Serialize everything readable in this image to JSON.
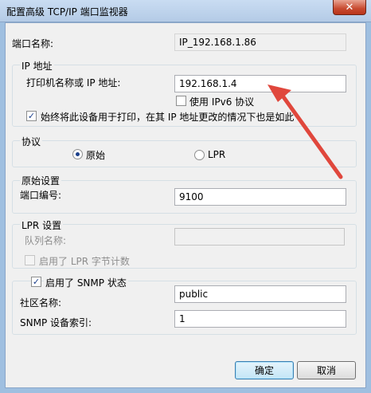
{
  "window": {
    "title": "配置高级 TCP/IP 端口监视器",
    "close_glyph": "✕"
  },
  "port_name": {
    "label": "端口名称:",
    "value": "IP_192.168.1.86"
  },
  "ip_group": {
    "title": "IP 地址",
    "printer_label": "打印机名称或 IP 地址:",
    "printer_value": "192.168.1.4",
    "ipv6_label": "使用 IPv6 协议",
    "ipv6_checked": false,
    "always_use_label": "始终将此设备用于打印，在其 IP 地址更改的情况下也是如此",
    "always_use_checked": true
  },
  "protocol_group": {
    "title": "协议",
    "raw_label": "原始",
    "lpr_label": "LPR",
    "selected": "raw"
  },
  "raw_group": {
    "title": "原始设置",
    "port_number_label": "端口编号:",
    "port_number_value": "9100"
  },
  "lpr_group": {
    "title": "LPR 设置",
    "queue_label": "队列名称:",
    "queue_value": "",
    "byte_count_label": "启用了 LPR 字节计数",
    "byte_count_checked": false
  },
  "snmp_group": {
    "title": "启用了 SNMP 状态",
    "enabled": true,
    "community_label": "社区名称:",
    "community_value": "public",
    "index_label": "SNMP 设备索引:",
    "index_value": "1"
  },
  "buttons": {
    "ok_label": "确定",
    "cancel_label": "取消"
  },
  "colors": {
    "arrow": "#e0473c",
    "check": "#1b3f8b"
  }
}
